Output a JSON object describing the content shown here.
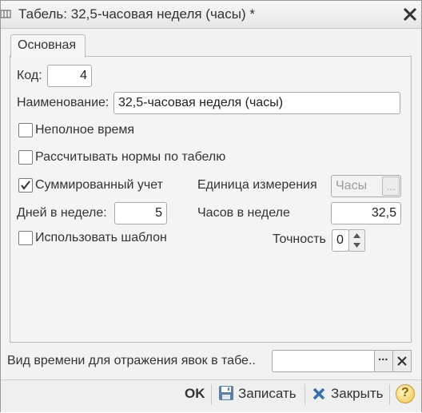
{
  "window": {
    "title": "Табель: 32,5-часовая неделя (часы) *"
  },
  "tabs": [
    {
      "label": "Основная"
    }
  ],
  "form": {
    "code": {
      "label": "Код:",
      "value": "4"
    },
    "name": {
      "label": "Наименование:",
      "value": "32,5-часовая неделя (часы)"
    },
    "part_time": {
      "label": "Неполное время",
      "checked": false
    },
    "calc_norms": {
      "label": "Рассчитывать нормы по табелю",
      "checked": false
    },
    "summed": {
      "label": "Суммированный учет",
      "checked": true
    },
    "unit": {
      "label": "Единица измерения",
      "value": "Часы",
      "button": "..."
    },
    "days_per_week": {
      "label": "Дней в неделе:",
      "value": "5"
    },
    "hours_per_week": {
      "label": "Часов в неделе",
      "value": "32,5"
    },
    "use_template": {
      "label": "Использовать шаблон",
      "checked": false
    },
    "precision": {
      "label": "Точность",
      "value": "0"
    }
  },
  "bottom_field": {
    "label": "Вид времени для отражения явок в табе..",
    "value": "",
    "select_button": "...",
    "clear_button": "✕"
  },
  "footer": {
    "ok": "OK",
    "save": "Записать",
    "close": "Закрыть",
    "help": "?"
  }
}
